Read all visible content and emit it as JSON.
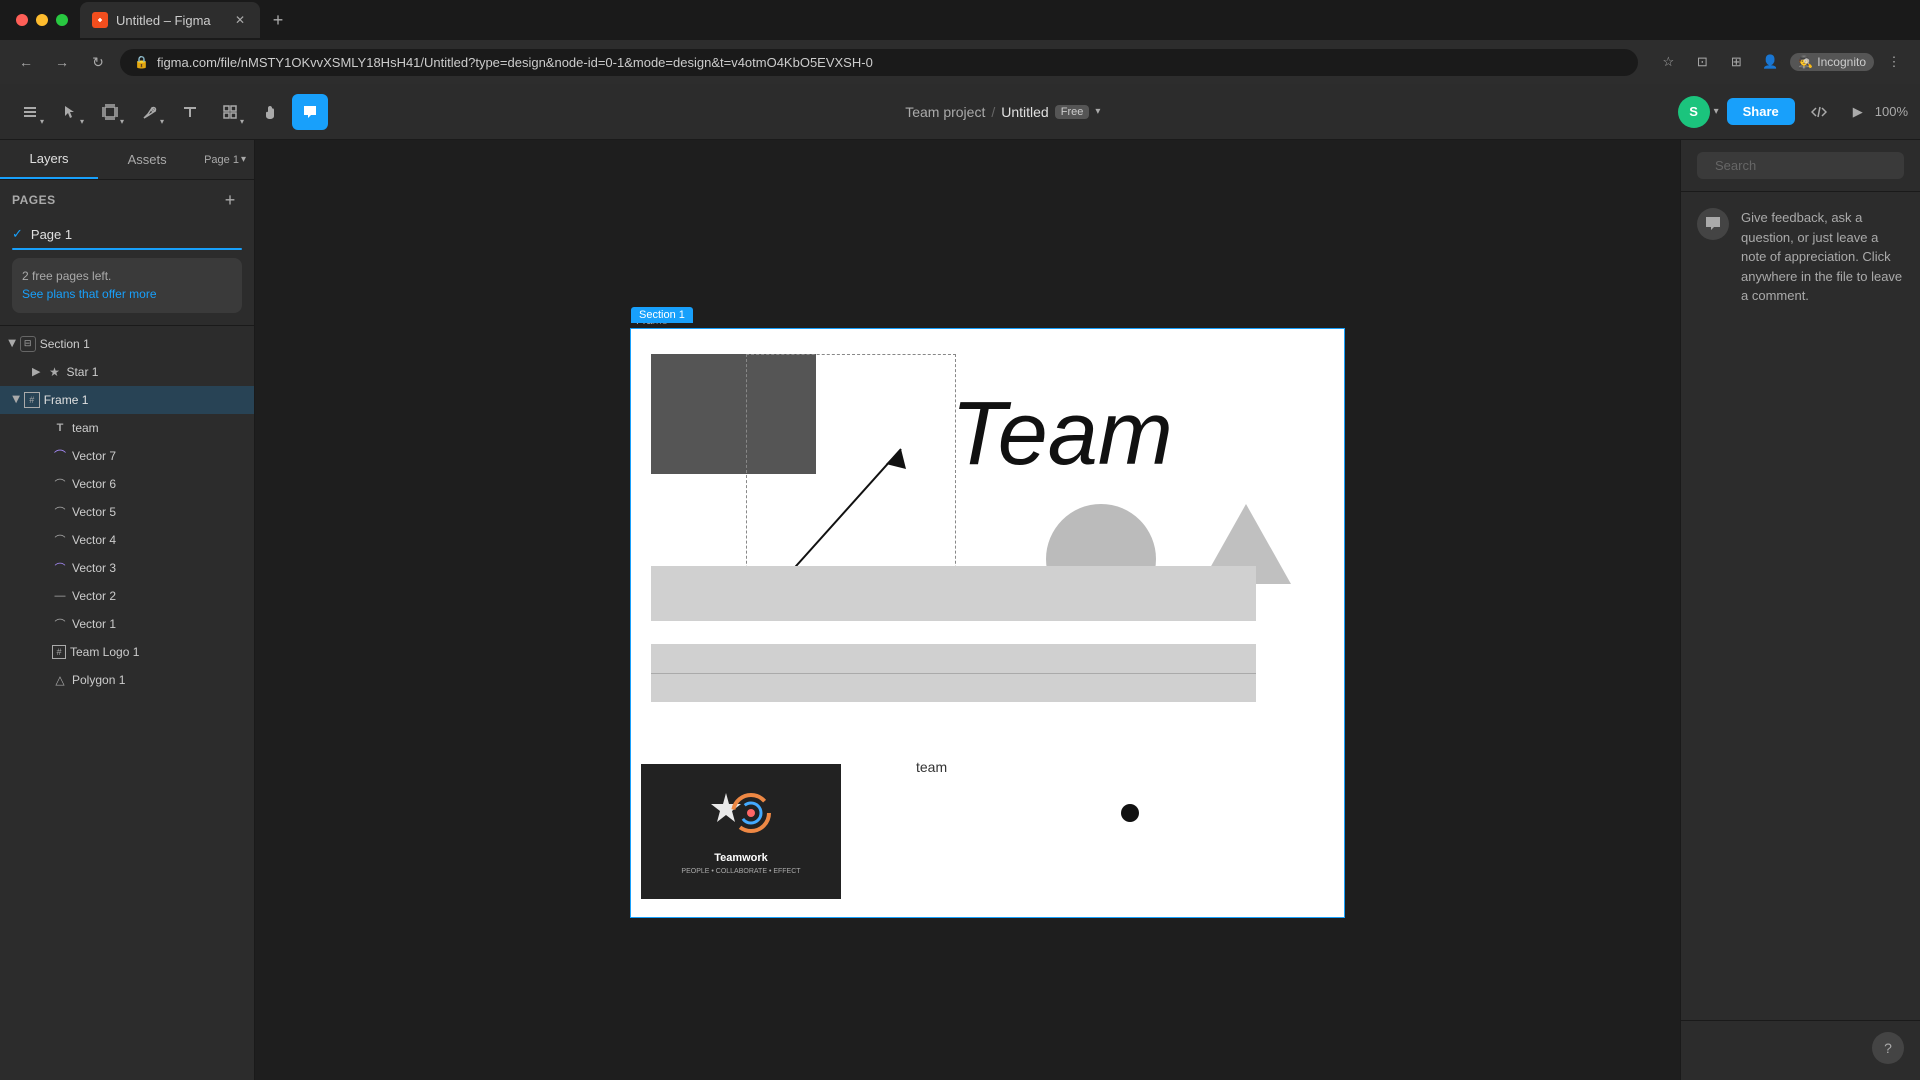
{
  "browser": {
    "tab_title": "Untitled – Figma",
    "tab_favicon": "F",
    "url": "figma.com/file/nMSTY1OKvvXSMLY18HsH41/Untitled?type=design&node-id=0-1&mode=design&t=v4otmO4KbO5EVXSH-0",
    "incognito_label": "Incognito",
    "new_tab_label": "+"
  },
  "toolbar": {
    "project_name": "Team project",
    "separator": "/",
    "file_name": "Untitled",
    "free_badge": "Free",
    "share_label": "Share",
    "zoom_level": "100%",
    "play_label": "▶"
  },
  "left_panel": {
    "tab_layers": "Layers",
    "tab_assets": "Assets",
    "page_selector": "Page 1",
    "pages_section": "Pages",
    "page_1": "Page 1",
    "free_notice": "2 free pages left.",
    "free_notice_link": "See plans that offer more",
    "layers": [
      {
        "name": "Section 1",
        "type": "section",
        "indent": 0,
        "expanded": true
      },
      {
        "name": "Star 1",
        "type": "star",
        "indent": 1,
        "expanded": false
      },
      {
        "name": "Frame 1",
        "type": "frame",
        "indent": 0,
        "expanded": true,
        "selected": true
      },
      {
        "name": "team",
        "type": "text",
        "indent": 1
      },
      {
        "name": "Vector 7",
        "type": "vector",
        "indent": 1
      },
      {
        "name": "Vector 6",
        "type": "vector",
        "indent": 1
      },
      {
        "name": "Vector 5",
        "type": "vector",
        "indent": 1
      },
      {
        "name": "Vector 4",
        "type": "vector",
        "indent": 1
      },
      {
        "name": "Vector 3",
        "type": "vector",
        "indent": 1
      },
      {
        "name": "Vector 2",
        "type": "vector",
        "indent": 1
      },
      {
        "name": "Vector 1",
        "type": "vector",
        "indent": 1
      },
      {
        "name": "Team Logo 1",
        "type": "frame",
        "indent": 1
      },
      {
        "name": "Polygon 1",
        "type": "polygon",
        "indent": 1
      }
    ]
  },
  "right_panel": {
    "search_placeholder": "Search",
    "comment_text": "Give feedback, ask a question, or just leave a note of appreciation. Click anywhere in the file to leave a comment."
  },
  "canvas": {
    "frame_label": "Frame",
    "section_label": "Section 1",
    "team_text": "team"
  }
}
